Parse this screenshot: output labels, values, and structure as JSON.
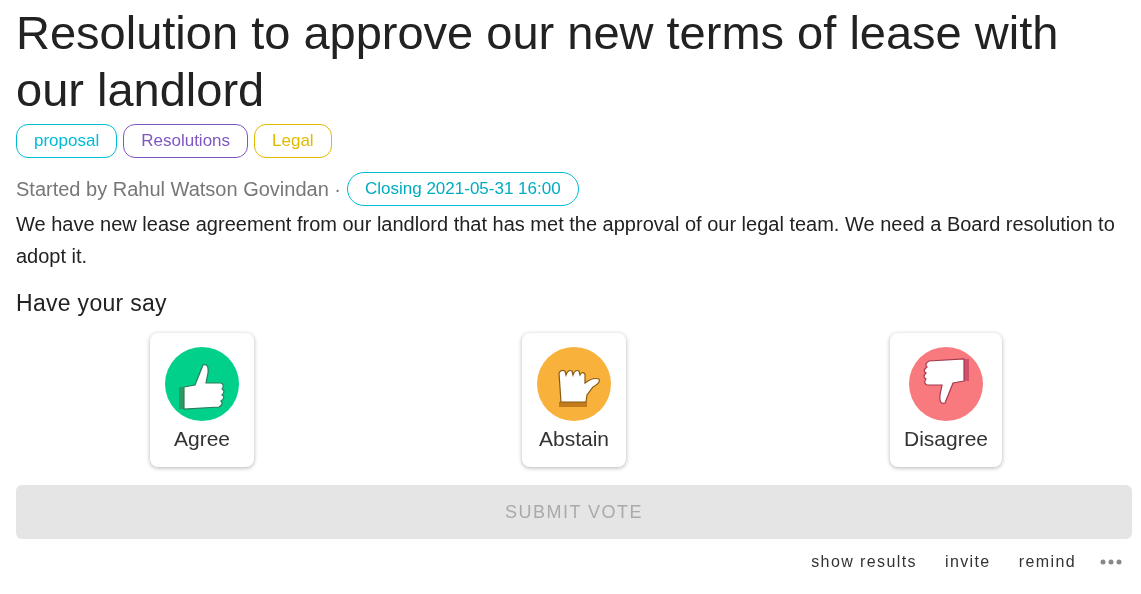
{
  "title": "Resolution to approve our new terms of lease with our landlord",
  "tags": [
    {
      "label": "proposal",
      "color": "#00bcd4"
    },
    {
      "label": "Resolutions",
      "color": "#7e57c2"
    },
    {
      "label": "Legal",
      "color": "#e0bb00"
    }
  ],
  "meta": {
    "started_by": "Started by Rahul Watson Govindan ·",
    "closing": "Closing 2021-05-31 16:00"
  },
  "description": "We have new lease agreement from our landlord that has met the approval of our legal team. We need a Board resolution to adopt it.",
  "vote": {
    "heading": "Have your say",
    "options": [
      {
        "kind": "agree",
        "label": "Agree",
        "color": "#00d08a"
      },
      {
        "kind": "abstain",
        "label": "Abstain",
        "color": "#f8b13a"
      },
      {
        "kind": "disagree",
        "label": "Disagree",
        "color": "#f87a7e"
      }
    ],
    "submit": {
      "label": "SUBMIT VOTE",
      "disabled": true
    }
  },
  "actions": [
    "show results",
    "invite",
    "remind"
  ]
}
